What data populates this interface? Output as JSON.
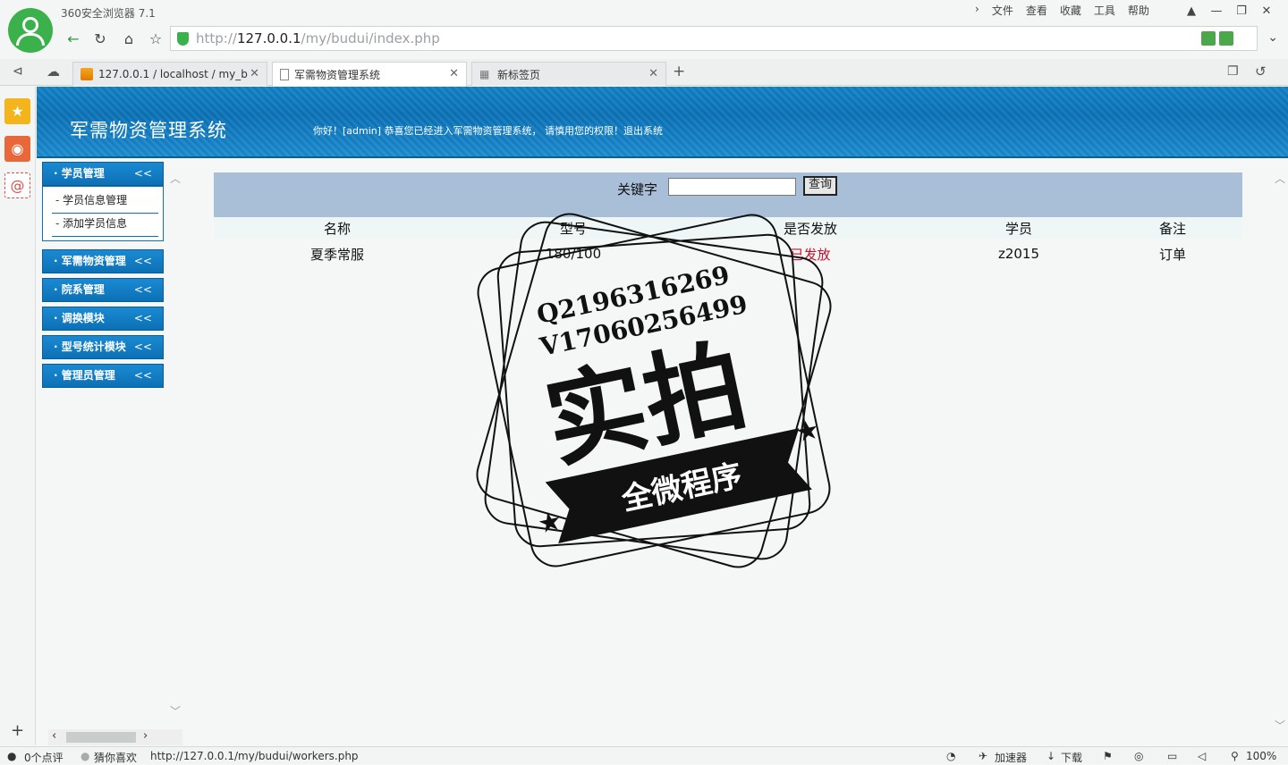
{
  "browser": {
    "title": "360安全浏览器 7.1",
    "menu": [
      "文件",
      "查看",
      "收藏",
      "工具",
      "帮助"
    ],
    "url_prefix": "http://",
    "url_host": "127.0.0.1",
    "url_path": "/my/budui/index.php",
    "tabs": [
      {
        "label": "127.0.0.1 / localhost / my_b",
        "active": false
      },
      {
        "label": "军需物资管理系统",
        "active": true
      },
      {
        "label": "新标签页",
        "active": false
      }
    ]
  },
  "header": {
    "system_title": "军需物资管理系统",
    "welcome": "你好！[admin] 恭喜您已经进入军需物资管理系统， 请慎用您的权限！退出系统"
  },
  "nav": {
    "groups": [
      {
        "label": "· 学员管理",
        "items": [
          "学员信息管理",
          "添加学员信息"
        ]
      },
      {
        "label": "· 军需物资管理"
      },
      {
        "label": "· 院系管理"
      },
      {
        "label": "· 调换模块"
      },
      {
        "label": "· 型号统计模块"
      },
      {
        "label": "· 管理员管理"
      }
    ],
    "collapse_glyph": "<<"
  },
  "search": {
    "label": "关键字",
    "value": "",
    "button": "查询"
  },
  "table": {
    "headers": [
      "名称",
      "型号",
      "是否发放",
      "学员",
      "备注"
    ],
    "rows": [
      [
        "夏季常服",
        "180/100",
        "已发放",
        "z2015",
        "订单"
      ]
    ]
  },
  "watermark": {
    "line1": "Q2196316269",
    "line2": "V17060256499",
    "main": "实拍",
    "banner": "全微程序"
  },
  "status": {
    "comments": "0个点评",
    "guess": "猜你喜欢",
    "hover_url": "http://127.0.0.1/my/budui/workers.php",
    "accelerator": "加速器",
    "download": "下载",
    "zoom": "100%"
  },
  "colors": {
    "header_blue": "#0b72b6",
    "search_bar": "#a9bfd8",
    "issued_red": "#c8102e"
  }
}
